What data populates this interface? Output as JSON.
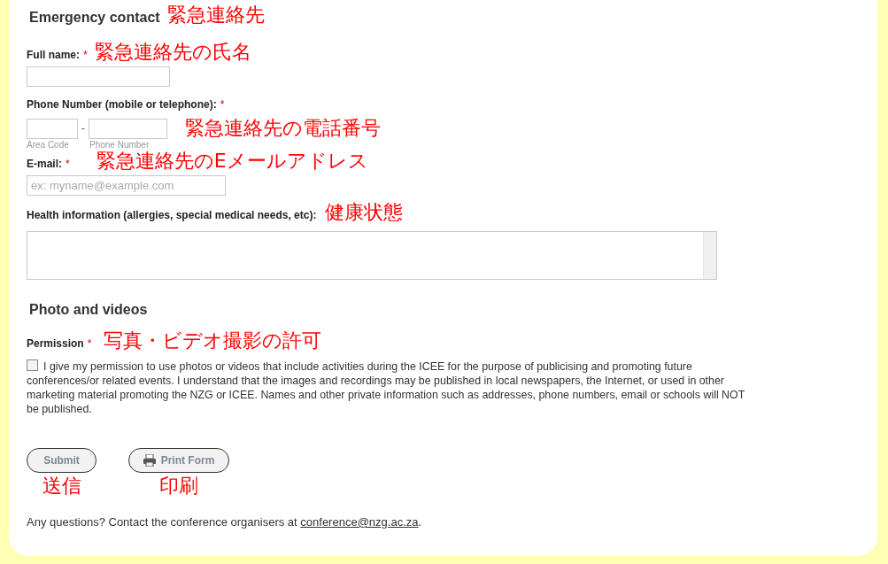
{
  "emergency": {
    "title": "Emergency contact",
    "note": "緊急連絡先",
    "full_name": {
      "label": "Full name:",
      "required_mark": "*",
      "note": "緊急連絡先の氏名"
    },
    "phone": {
      "label": "Phone Number (mobile or telephone):",
      "required_mark": "*",
      "separator": "-",
      "area_sublabel": "Area Code",
      "number_sublabel": "Phone Number",
      "note": "緊急連絡先の電話番号"
    },
    "email": {
      "label": "E-mail:",
      "required_mark": "*",
      "placeholder": "ex: myname@example.com",
      "note": "緊急連絡先のEメールアドレス"
    },
    "health": {
      "label": "Health information (allergies, special medical needs, etc):",
      "note": "健康状態"
    }
  },
  "photos": {
    "title": "Photo and videos",
    "permission": {
      "label": "Permission",
      "required_mark": "*",
      "note": "写真・ビデオ撮影の許可",
      "checked": false,
      "text": "I give my permission to use photos or videos that include activities during the ICEE for the purpose of publicising and promoting future conferences/or related events. I understand that the images and recordings may be published in local newspapers, the Internet, or used in other marketing material promoting the NZG or ICEE. Names and other private information such as addresses, phone numbers, email or schools will NOT be published."
    }
  },
  "buttons": [
    {
      "kind": "submit",
      "label": "Submit",
      "note": "送信"
    },
    {
      "kind": "print",
      "label": "Print Form",
      "note": "印刷"
    }
  ],
  "footer": {
    "text": "Any questions? Contact the conference organisers at",
    "email": "conference@nzg.ac.za",
    "end": "."
  }
}
